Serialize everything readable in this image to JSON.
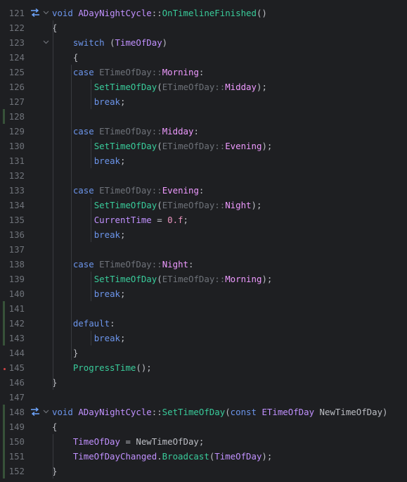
{
  "editor": {
    "markers": [
      "swap-arrows-icon",
      "swap-arrows-icon"
    ],
    "lines": [
      {
        "num": "121",
        "tokens": [
          [
            "k",
            "void"
          ],
          [
            "p",
            " "
          ],
          [
            "t",
            "ADayNightCycle"
          ],
          [
            "p",
            "::"
          ],
          [
            "f",
            "OnTimelineFinished"
          ],
          [
            "p",
            "()"
          ]
        ]
      },
      {
        "num": "122",
        "tokens": [
          [
            "p",
            "{"
          ]
        ]
      },
      {
        "num": "123",
        "tokens": [
          [
            "p",
            "    "
          ],
          [
            "k",
            "switch"
          ],
          [
            "p",
            " ("
          ],
          [
            "t",
            "TimeOfDay"
          ],
          [
            "p",
            ")"
          ]
        ]
      },
      {
        "num": "124",
        "tokens": [
          [
            "p",
            "    {"
          ]
        ]
      },
      {
        "num": "125",
        "tokens": [
          [
            "p",
            "    "
          ],
          [
            "k",
            "case"
          ],
          [
            "p",
            " "
          ],
          [
            "en",
            "ETimeOfDay::"
          ],
          [
            "m",
            "Morning"
          ],
          [
            "p",
            ":"
          ]
        ]
      },
      {
        "num": "126",
        "tokens": [
          [
            "p",
            "        "
          ],
          [
            "f",
            "SetTimeOfDay"
          ],
          [
            "p",
            "("
          ],
          [
            "en",
            "ETimeOfDay::"
          ],
          [
            "m",
            "Midday"
          ],
          [
            "p",
            ");"
          ]
        ]
      },
      {
        "num": "127",
        "tokens": [
          [
            "p",
            "        "
          ],
          [
            "k",
            "break"
          ],
          [
            "p",
            ";"
          ]
        ]
      },
      {
        "num": "128",
        "tokens": []
      },
      {
        "num": "129",
        "tokens": [
          [
            "p",
            "    "
          ],
          [
            "k",
            "case"
          ],
          [
            "p",
            " "
          ],
          [
            "en",
            "ETimeOfDay::"
          ],
          [
            "m",
            "Midday"
          ],
          [
            "p",
            ":"
          ]
        ]
      },
      {
        "num": "130",
        "tokens": [
          [
            "p",
            "        "
          ],
          [
            "f",
            "SetTimeOfDay"
          ],
          [
            "p",
            "("
          ],
          [
            "en",
            "ETimeOfDay::"
          ],
          [
            "m",
            "Evening"
          ],
          [
            "p",
            ");"
          ]
        ]
      },
      {
        "num": "131",
        "tokens": [
          [
            "p",
            "        "
          ],
          [
            "k",
            "break"
          ],
          [
            "p",
            ";"
          ]
        ]
      },
      {
        "num": "132",
        "tokens": []
      },
      {
        "num": "133",
        "tokens": [
          [
            "p",
            "    "
          ],
          [
            "k",
            "case"
          ],
          [
            "p",
            " "
          ],
          [
            "en",
            "ETimeOfDay::"
          ],
          [
            "m",
            "Evening"
          ],
          [
            "p",
            ":"
          ]
        ]
      },
      {
        "num": "134",
        "tokens": [
          [
            "p",
            "        "
          ],
          [
            "f",
            "SetTimeOfDay"
          ],
          [
            "p",
            "("
          ],
          [
            "en",
            "ETimeOfDay::"
          ],
          [
            "m",
            "Night"
          ],
          [
            "p",
            ");"
          ]
        ]
      },
      {
        "num": "135",
        "tokens": [
          [
            "p",
            "        "
          ],
          [
            "t",
            "CurrentTime"
          ],
          [
            "p",
            " = "
          ],
          [
            "n",
            "0.f"
          ],
          [
            "p",
            ";"
          ]
        ]
      },
      {
        "num": "136",
        "tokens": [
          [
            "p",
            "        "
          ],
          [
            "k",
            "break"
          ],
          [
            "p",
            ";"
          ]
        ]
      },
      {
        "num": "137",
        "tokens": []
      },
      {
        "num": "138",
        "tokens": [
          [
            "p",
            "    "
          ],
          [
            "k",
            "case"
          ],
          [
            "p",
            " "
          ],
          [
            "en",
            "ETimeOfDay::"
          ],
          [
            "m",
            "Night"
          ],
          [
            "p",
            ":"
          ]
        ]
      },
      {
        "num": "139",
        "tokens": [
          [
            "p",
            "        "
          ],
          [
            "f",
            "SetTimeOfDay"
          ],
          [
            "p",
            "("
          ],
          [
            "en",
            "ETimeOfDay::"
          ],
          [
            "m",
            "Morning"
          ],
          [
            "p",
            ");"
          ]
        ]
      },
      {
        "num": "140",
        "tokens": [
          [
            "p",
            "        "
          ],
          [
            "k",
            "break"
          ],
          [
            "p",
            ";"
          ]
        ]
      },
      {
        "num": "141",
        "tokens": []
      },
      {
        "num": "142",
        "tokens": [
          [
            "p",
            "    "
          ],
          [
            "k",
            "default"
          ],
          [
            "p",
            ":"
          ]
        ]
      },
      {
        "num": "143",
        "tokens": [
          [
            "p",
            "        "
          ],
          [
            "k",
            "break"
          ],
          [
            "p",
            ";"
          ]
        ]
      },
      {
        "num": "144",
        "tokens": [
          [
            "p",
            "    }"
          ]
        ]
      },
      {
        "num": "145",
        "tokens": [
          [
            "p",
            "    "
          ],
          [
            "f",
            "ProgressTime"
          ],
          [
            "p",
            "();"
          ]
        ]
      },
      {
        "num": "146",
        "tokens": [
          [
            "p",
            "}"
          ]
        ]
      },
      {
        "num": "147",
        "tokens": []
      },
      {
        "num": "148",
        "tokens": [
          [
            "k",
            "void"
          ],
          [
            "p",
            " "
          ],
          [
            "t",
            "ADayNightCycle"
          ],
          [
            "p",
            "::"
          ],
          [
            "f",
            "SetTimeOfDay"
          ],
          [
            "p",
            "("
          ],
          [
            "k",
            "const"
          ],
          [
            "p",
            " "
          ],
          [
            "t",
            "ETimeOfDay"
          ],
          [
            "p",
            " NewTimeOfDay)"
          ]
        ]
      },
      {
        "num": "149",
        "tokens": [
          [
            "p",
            "{"
          ]
        ]
      },
      {
        "num": "150",
        "tokens": [
          [
            "p",
            "    "
          ],
          [
            "t",
            "TimeOfDay"
          ],
          [
            "p",
            " = NewTimeOfDay;"
          ]
        ]
      },
      {
        "num": "151",
        "tokens": [
          [
            "p",
            "    "
          ],
          [
            "t",
            "TimeOfDayChanged"
          ],
          [
            "p",
            "."
          ],
          [
            "f",
            "Broadcast"
          ],
          [
            "p",
            "("
          ],
          [
            "t",
            "TimeOfDay"
          ],
          [
            "p",
            ");"
          ]
        ]
      },
      {
        "num": "152",
        "tokens": [
          [
            "p",
            "}"
          ]
        ]
      }
    ]
  }
}
